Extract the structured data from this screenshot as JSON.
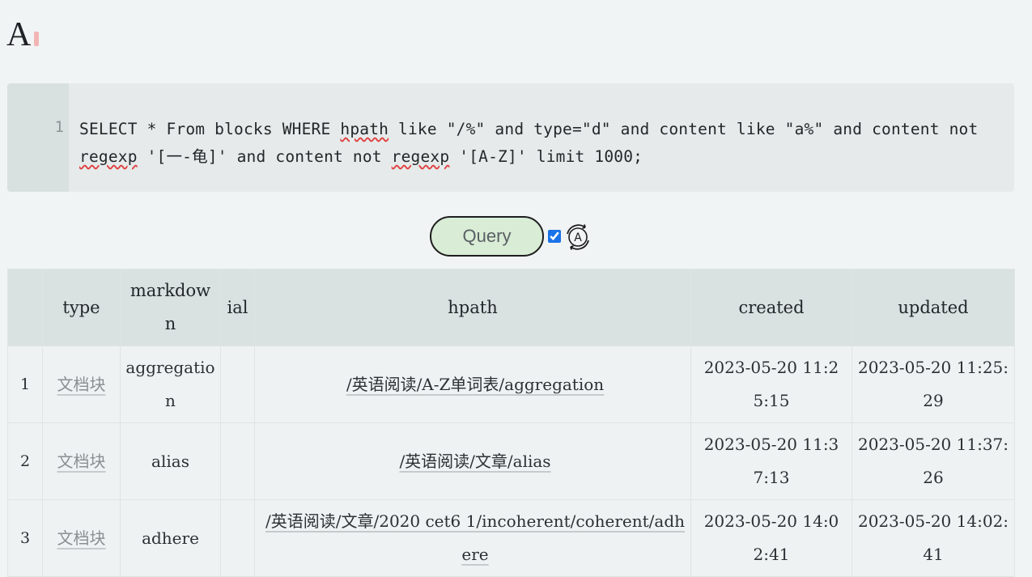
{
  "heading": {
    "title": "A"
  },
  "code_block": {
    "line_number": "1",
    "parts": {
      "p1": "SELECT * From blocks WHERE ",
      "w1": "hpath",
      "p2": " like \"/%\" and type=\"d\" and content like \"a%\" and content not ",
      "w2": "regexp",
      "p3": " '[一-龟]' and content not ",
      "w3": "regexp",
      "p4": " '[A-Z]' limit 1000;"
    }
  },
  "toolbar": {
    "query_label": "Query",
    "auto_checked": true,
    "auto_icon": "auto-refresh-a-icon"
  },
  "table": {
    "headers": [
      "",
      "type",
      "markdown",
      "ial",
      "hpath",
      "created",
      "updated"
    ],
    "rows": [
      {
        "num": "1",
        "type": "文档块",
        "markdown": "aggregation",
        "ial": "",
        "hpath": "/英语阅读/A-Z单词表/aggregation",
        "created": "2023-05-20 11:25:15",
        "updated": "2023-05-20 11:25:29"
      },
      {
        "num": "2",
        "type": "文档块",
        "markdown": "alias",
        "ial": "",
        "hpath": "/英语阅读/文章/alias",
        "created": "2023-05-20 11:37:13",
        "updated": "2023-05-20 11:37:26"
      },
      {
        "num": "3",
        "type": "文档块",
        "markdown": "adhere",
        "ial": "",
        "hpath": "/英语阅读/文章/2020 cet6 1/incoherent/coherent/adhere",
        "created": "2023-05-20 14:02:41",
        "updated": "2023-05-20 14:02:41"
      }
    ]
  },
  "colors": {
    "background": "#f1f4f4",
    "code_bg": "#e6eaea",
    "header_bg": "#d9e1e1",
    "query_button_bg": "#d8ecd6",
    "link_gray": "#8a8f93"
  }
}
